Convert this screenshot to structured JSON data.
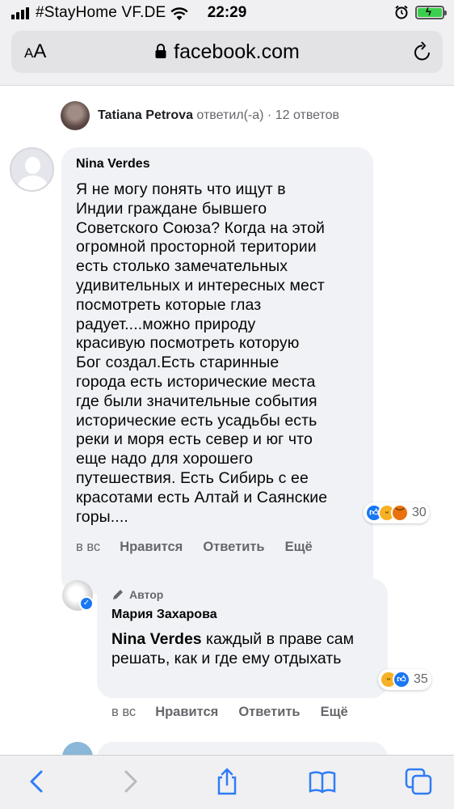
{
  "status_bar": {
    "carrier": "#StayHome VF.DE",
    "time": "22:29",
    "battery_level": 1.0
  },
  "browser": {
    "text_size_label_small": "A",
    "text_size_label_large": "A",
    "url": "facebook.com"
  },
  "thread": {
    "reply_summary": {
      "name": "Tatiana Petrova",
      "action": "ответил(-а)",
      "separator": "·",
      "replies": "12 ответов"
    },
    "comment": {
      "author": "Nina Verdes",
      "text": "Я не могу понять что ищут в\nИндии граждане бывшего\nСоветского Союза? Когда на этой\nогромной просторной територии\nесть столько замечательных\nудивительных и интересных мест\nпосмотреть которые глаз\nрадует....можно природу\nкрасивую посмотреть которую\nБог создал.Есть старинные\nгорода есть исторические места\nгде были значительные события\nисторические есть усадьбы есть\nреки и моря есть север и юг что\nеще надо для хорошего\nпутешествия. Есть Сибирь с ее\nкрасотами есть Алтай и Саянские\nгоры....",
      "reaction_count": "30",
      "time": "в вс",
      "like_label": "Нравится",
      "reply_label": "Ответить",
      "more_label": "Ещё"
    },
    "reply": {
      "badge": "Автор",
      "author": "Мария Захарова",
      "mention": "Nina Verdes",
      "text": " каждый в праве сам решать, как и где ему отдыхать",
      "reaction_count": "35",
      "time": "в вс",
      "like_label": "Нравится",
      "reply_label": "Ответить",
      "more_label": "Ещё"
    }
  },
  "colors": {
    "bubble": "#f0f2f5",
    "like_blue": "#1877f2",
    "haha_yellow": "#f7b125",
    "angry_orange": "#e9710f",
    "secondary_text": "#65676b",
    "toolbar_icon": "#2f7cf6"
  },
  "icons": [
    "wifi-icon",
    "alarm-icon",
    "lock-icon",
    "reload-icon",
    "pen-icon",
    "back-icon",
    "forward-icon",
    "share-icon",
    "bookmarks-icon",
    "tabs-icon"
  ]
}
